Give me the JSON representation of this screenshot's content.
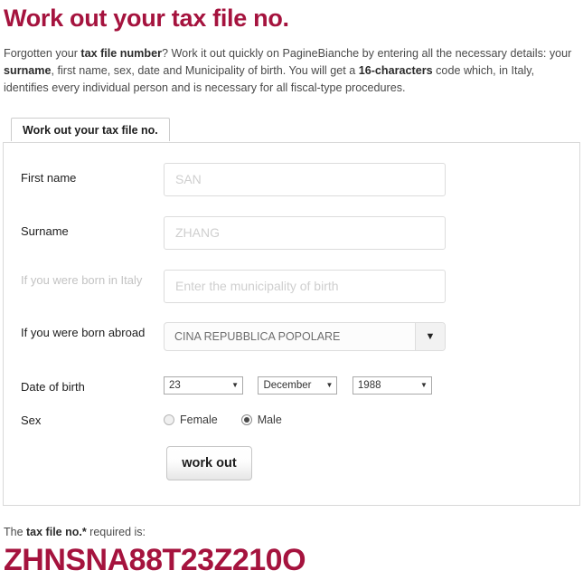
{
  "page": {
    "title": "Work out your tax file no.",
    "intro_parts": {
      "p1": "Forgotten your ",
      "b1": "tax file number",
      "p2": "? Work it out quickly on PagineBianche by entering all the necessary details: your ",
      "b2": "surname",
      "p3": ", first name, sex, date and Municipality of birth. You will get a ",
      "b3": "16-characters",
      "p4": " code which, in Italy, identifies every individual person and is necessary for all fiscal-type procedures."
    }
  },
  "tab": {
    "label": "Work out your tax file no."
  },
  "form": {
    "first_name": {
      "label": "First name",
      "value": "SAN",
      "placeholder": "SAN"
    },
    "surname": {
      "label": "Surname",
      "value": "ZHANG",
      "placeholder": "ZHANG"
    },
    "born_in_italy": {
      "label": "If you were born in Italy",
      "value": "",
      "placeholder": "Enter the municipality of birth",
      "state": "disabled"
    },
    "born_abroad": {
      "label": "If you were born abroad",
      "value": "CINA REPUBBLICA POPOLARE",
      "arrow": "▼"
    },
    "date_of_birth": {
      "label": "Date of birth",
      "day": "23",
      "month": "December",
      "year": "1988",
      "arrow": "▼"
    },
    "sex": {
      "label": "Sex",
      "options": [
        {
          "label": "Female",
          "checked": false
        },
        {
          "label": "Male",
          "checked": true
        }
      ]
    },
    "submit": {
      "label": "work out"
    }
  },
  "result": {
    "label_p1": "The ",
    "label_b": "tax file no.*",
    "label_p2": " required is:",
    "code": "ZHNSNA88T23Z210O"
  },
  "colors": {
    "brand": "#A5133E",
    "text": "#333333",
    "disabled": "#c3c3c3"
  }
}
